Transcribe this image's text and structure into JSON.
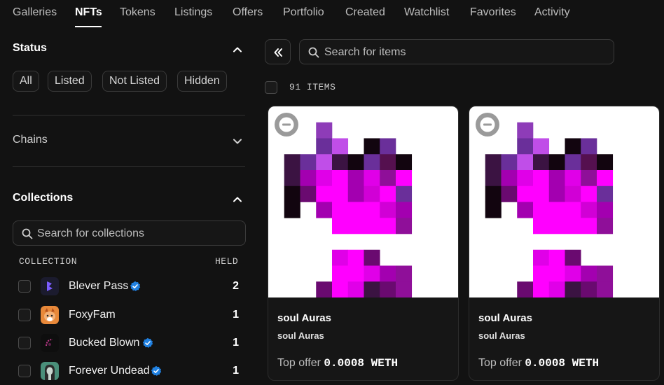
{
  "nav": {
    "tabs": [
      "Galleries",
      "NFTs",
      "Tokens",
      "Listings",
      "Offers",
      "Portfolio",
      "Created",
      "Watchlist",
      "Favorites",
      "Activity"
    ],
    "active_tab": "NFTs"
  },
  "filters": {
    "status": {
      "title": "Status",
      "expanded": true,
      "options": [
        "All",
        "Listed",
        "Not Listed",
        "Hidden"
      ]
    },
    "chains": {
      "title": "Chains",
      "expanded": false
    },
    "collections": {
      "title": "Collections",
      "expanded": true,
      "search_placeholder": "Search for collections",
      "col_collection": "COLLECTION",
      "col_held": "HELD",
      "items": [
        {
          "name": "Blever Pass",
          "verified": true,
          "held": "2",
          "avatar_icon": "blever-logo-icon",
          "avatar_color": "#1b1b2e"
        },
        {
          "name": "FoxyFam",
          "verified": false,
          "held": "1",
          "avatar_icon": "fox-avatar-icon",
          "avatar_color": "#e8893a"
        },
        {
          "name": "Bucked Blown",
          "verified": true,
          "held": "1",
          "avatar_icon": "bucked-blown-avatar-icon",
          "avatar_color": "#0e0e0e"
        },
        {
          "name": "Forever Undead",
          "verified": true,
          "held": "1",
          "avatar_icon": "undead-avatar-icon",
          "avatar_color": "#4a8f7a"
        }
      ]
    }
  },
  "main": {
    "search_placeholder": "Search for items",
    "items_count": "91 ITEMS",
    "cards": [
      {
        "title": "soul Auras",
        "collection": "soul Auras",
        "offer_label": "Top offer",
        "offer_value": "0.0008 WETH"
      },
      {
        "title": "soul Auras",
        "collection": "soul Auras",
        "offer_label": "Top offer",
        "offer_value": "0.0008 WETH"
      }
    ]
  },
  "colors": {
    "background": "#121212",
    "verified_badge": "#2081e2",
    "nft_magenta": "#ff00ff",
    "nft_purple": "#8a2d9e"
  }
}
